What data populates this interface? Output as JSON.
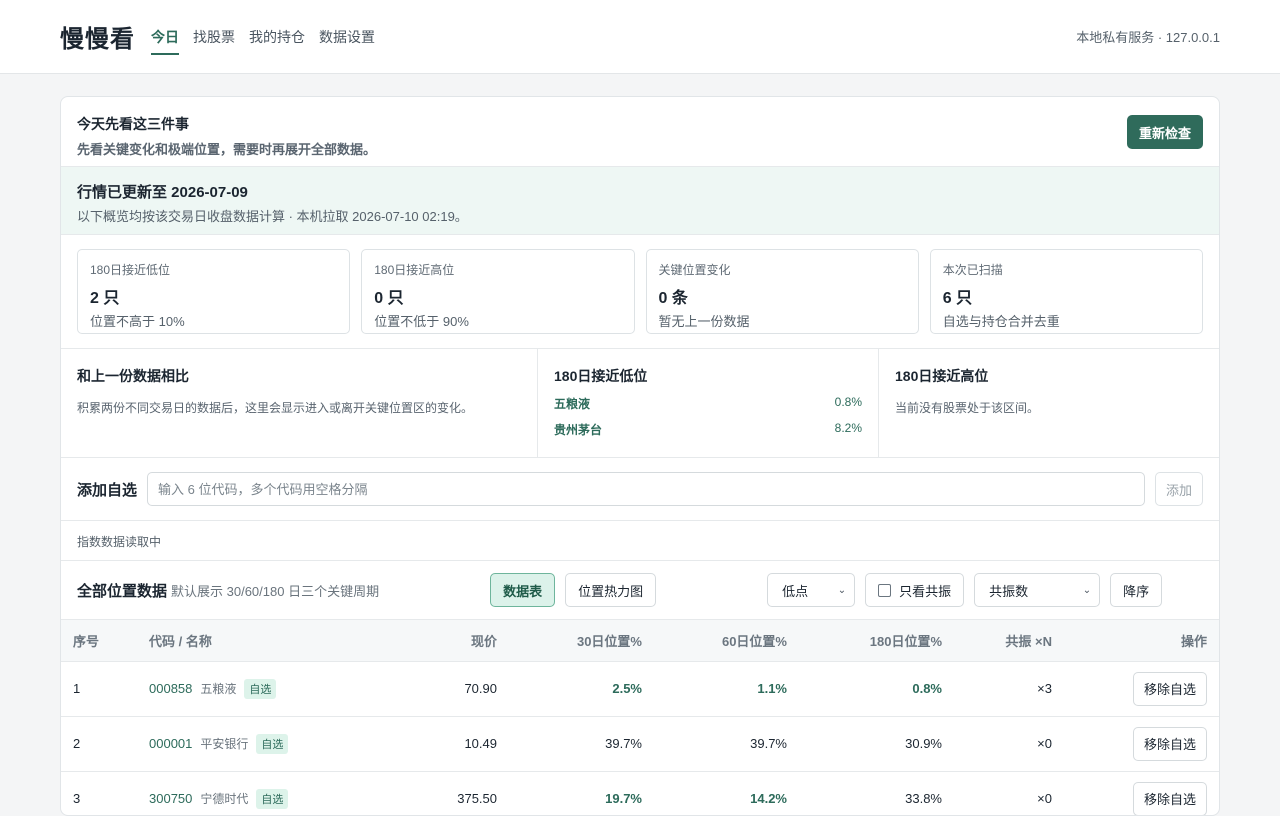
{
  "header": {
    "brand": "慢慢看",
    "nav": [
      "今日",
      "找股票",
      "我的持仓",
      "数据设置"
    ],
    "server": "本地私有服务 · 127.0.0.1"
  },
  "intro": {
    "title": "今天先看这三件事",
    "subtitle": "先看关键变化和极端位置，需要时再展开全部数据。",
    "recheck_label": "重新检查"
  },
  "update": {
    "title": "行情已更新至 2026-07-09",
    "subtitle": "以下概览均按该交易日收盘数据计算 · 本机拉取 2026-07-10 02:19。"
  },
  "stats": [
    {
      "label": "180日接近低位",
      "value": "2 只",
      "desc": "位置不高于 10%"
    },
    {
      "label": "180日接近高位",
      "value": "0 只",
      "desc": "位置不低于 90%"
    },
    {
      "label": "关键位置变化",
      "value": "0 条",
      "desc": "暂无上一份数据"
    },
    {
      "label": "本次已扫描",
      "value": "6 只",
      "desc": "自选与持仓合并去重"
    }
  ],
  "compare": {
    "title": "和上一份数据相比",
    "text": "积累两份不同交易日的数据后，这里会显示进入或离开关键位置区的变化。"
  },
  "low_zone": {
    "title": "180日接近低位",
    "items": [
      {
        "name": "五粮液",
        "value": "0.8%"
      },
      {
        "name": "贵州茅台",
        "value": "8.2%"
      }
    ]
  },
  "high_zone": {
    "title": "180日接近高位",
    "text": "当前没有股票处于该区间。"
  },
  "add_watch": {
    "label": "添加自选",
    "placeholder": "输入 6 位代码，多个代码用空格分隔",
    "button": "添加"
  },
  "index_status": "指数数据读取中",
  "tools": {
    "title": "全部位置数据",
    "subtitle": "默认展示 30/60/180 日三个关键周期",
    "view_table": "数据表",
    "view_heatmap": "位置热力图",
    "metric_select": "低点",
    "resonance_only": "只看共振",
    "sort_select": "共振数",
    "order": "降序"
  },
  "table": {
    "headers": [
      "序号",
      "代码 / 名称",
      "现价",
      "30日位置%",
      "60日位置%",
      "180日位置%",
      "共振 ×N",
      "操作"
    ],
    "tag_label": "自选",
    "action_label": "移除自选",
    "rows": [
      {
        "idx": "1",
        "code": "000858",
        "name": "五粮液",
        "price": "70.90",
        "p30": "2.5%",
        "p60": "1.1%",
        "p180": "0.8%",
        "res": "×3"
      },
      {
        "idx": "2",
        "code": "000001",
        "name": "平安银行",
        "price": "10.49",
        "p30": "39.7%",
        "p60": "39.7%",
        "p180": "30.9%",
        "res": "×0"
      },
      {
        "idx": "3",
        "code": "300750",
        "name": "宁德时代",
        "price": "375.50",
        "p30": "19.7%",
        "p60": "14.2%",
        "p180": "33.8%",
        "res": "×0"
      }
    ]
  }
}
